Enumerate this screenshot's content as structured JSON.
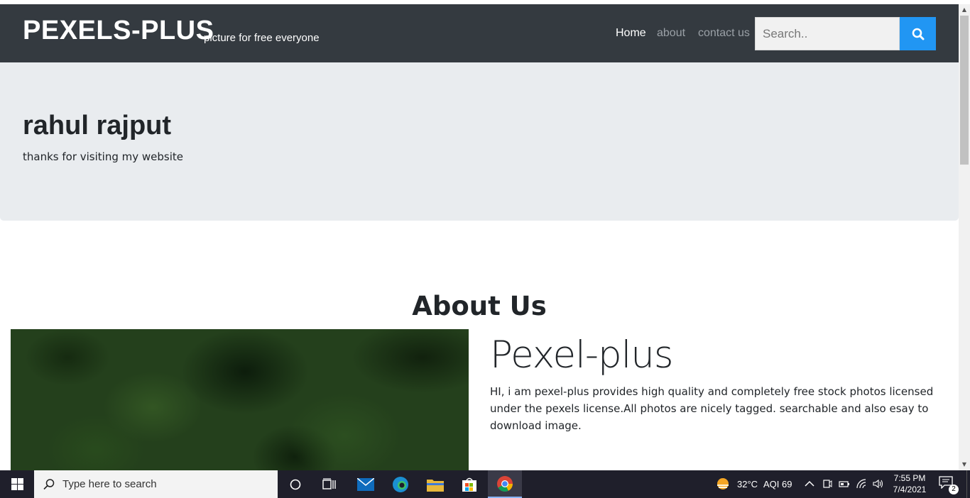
{
  "navbar": {
    "brand": "PEXELS-PLUS",
    "tagline": "picture for free everyone",
    "links": [
      "Home",
      "about",
      "contact us"
    ],
    "search_placeholder": "Search.."
  },
  "jumbotron": {
    "title": "rahul rajput",
    "text": "thanks for visiting my website"
  },
  "about": {
    "heading": "About Us",
    "title": "Pexel-plus",
    "text": "HI, i am pexel-plus provides high quality and completely free stock photos licensed under the pexels license.All photos are nicely tagged. searchable and also esay to download image."
  },
  "taskbar": {
    "search_placeholder": "Type here to search",
    "weather": "32°C",
    "aqi": "AQI 69",
    "time": "7:55 PM",
    "date": "7/4/2021",
    "notification_count": "2"
  },
  "colors": {
    "navbar_bg": "#343a40",
    "search_button": "#2196f3",
    "jumbotron_bg": "#e9ecef",
    "taskbar_bg": "#1f1f2b"
  }
}
